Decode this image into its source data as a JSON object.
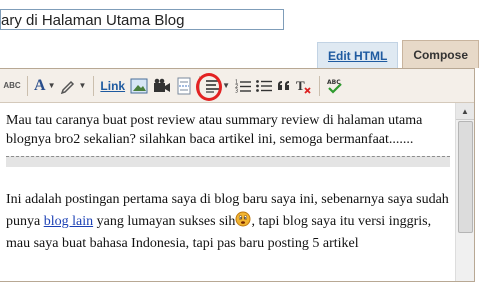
{
  "post_title": "ary di Halaman Utama Blog",
  "tabs": {
    "edit_html": "Edit HTML",
    "compose": "Compose"
  },
  "toolbar": {
    "spellcheck_small_label": "ABC",
    "link_label": "Link",
    "spellcheck_label": "ABC"
  },
  "content": {
    "paragraph1": "Mau tau caranya buat post review atau summary review di halaman utama blognya bro2 sekalian? silahkan baca artikel ini, semoga bermanfaat.......",
    "p2_text1": "Ini adalah postingan pertama saya di blog baru saya ini, sebenarnya saya sudah punya ",
    "p2_link": "blog lain",
    "p2_text2": " yang lumayan sukses sih",
    "p2_text3": ", tapi blog saya itu versi inggris, mau saya buat bahasa Indonesia, tapi pas baru posting 5 artikel"
  },
  "colors": {
    "toolbar_bg": "#f4efe9",
    "highlight_ring": "#e32222",
    "link": "#1a3fb4"
  }
}
